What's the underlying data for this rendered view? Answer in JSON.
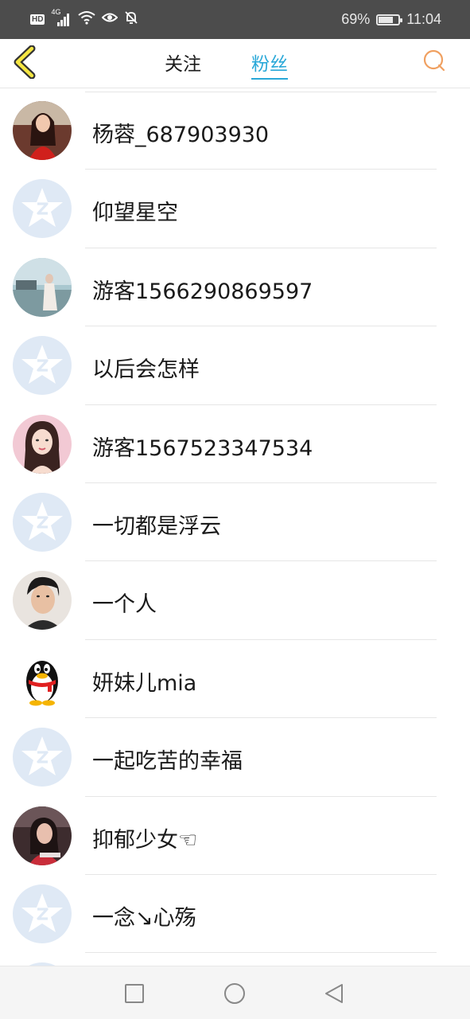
{
  "status_bar": {
    "network_badge": "HD",
    "network_type": "4G",
    "battery_percent": "69%",
    "time": "11:04",
    "icons": [
      "hd-icon",
      "signal-icon",
      "wifi-icon",
      "eye-icon",
      "mute-bell-icon",
      "battery-icon"
    ]
  },
  "header": {
    "tabs": [
      {
        "label": "关注",
        "active": false
      },
      {
        "label": "粉丝",
        "active": true
      }
    ],
    "accent_color": "#29a8d8",
    "back_icon": "chevron-left-icon",
    "search_icon": "search-icon"
  },
  "fans": [
    {
      "name": "杨蓉_687903930",
      "avatar": "photo-woman-red"
    },
    {
      "name": "仰望星空",
      "avatar": "default-z-avatar"
    },
    {
      "name": "游客1566290869597",
      "avatar": "photo-scenery"
    },
    {
      "name": "以后会怎样",
      "avatar": "default-z-avatar"
    },
    {
      "name": "游客1567523347534",
      "avatar": "photo-woman-pink"
    },
    {
      "name": "一切都是浮云",
      "avatar": "default-z-avatar"
    },
    {
      "name": "一个人",
      "avatar": "photo-man"
    },
    {
      "name": "妍妹儿mia",
      "avatar": "qq-penguin-avatar"
    },
    {
      "name": "一起吃苦的幸福",
      "avatar": "default-z-avatar"
    },
    {
      "name": "抑郁少女☜",
      "avatar": "photo-girl"
    },
    {
      "name": "一念↘心殇",
      "avatar": "default-z-avatar"
    }
  ],
  "nav_bar": {
    "buttons": [
      "recents-square-icon",
      "home-circle-icon",
      "back-triangle-icon"
    ]
  }
}
